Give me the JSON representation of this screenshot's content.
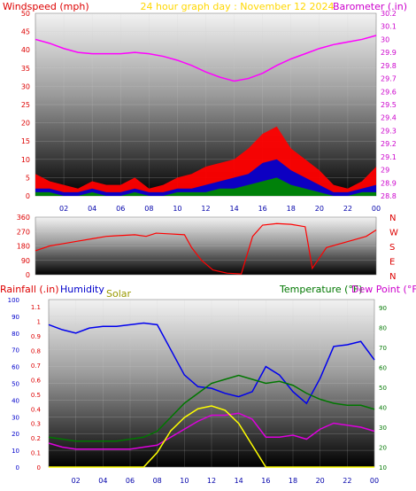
{
  "header": {
    "left_label": "Windspeed (mph)",
    "center_label": "24 hour graph day : November 12 2024",
    "right_label": "Barometer (.in)"
  },
  "colors": {
    "wind_label": "#dd0000",
    "title": "#ffd700",
    "baro_label": "#cc00cc",
    "rain_label": "#dd0000",
    "humidity_label": "#0000cc",
    "solar_label": "#999900",
    "temp_label": "#007700",
    "dew_label": "#cc00cc"
  },
  "chart_data": [
    {
      "type": "line",
      "name": "wind-barometer",
      "x": [
        0,
        1,
        2,
        3,
        4,
        5,
        6,
        7,
        8,
        9,
        10,
        11,
        12,
        13,
        14,
        15,
        16,
        17,
        18,
        19,
        20,
        21,
        22,
        23,
        24
      ],
      "x_ticks": [
        "02",
        "04",
        "06",
        "08",
        "10",
        "12",
        "14",
        "16",
        "18",
        "20",
        "22",
        "00"
      ],
      "left_axis": {
        "ticks": [
          "0",
          "5",
          "10",
          "15",
          "20",
          "25",
          "30",
          "35",
          "40",
          "45",
          "50"
        ],
        "ylim": [
          0,
          50
        ]
      },
      "right_axis": {
        "ticks": [
          "28.8",
          "28.9",
          "29",
          "29.1",
          "29.2",
          "29.3",
          "29.4",
          "29.5",
          "29.6",
          "29.7",
          "29.8",
          "29.9",
          "30",
          "30.1",
          "30.2"
        ],
        "ylim": [
          28.8,
          30.2
        ]
      },
      "series": [
        {
          "axis": "left",
          "color": "#ff0000",
          "values": [
            6,
            4,
            3,
            2,
            4,
            3,
            3,
            5,
            2,
            3,
            5,
            6,
            8,
            9,
            10,
            13,
            17,
            19,
            13,
            10,
            7,
            3,
            2,
            4,
            8
          ]
        },
        {
          "axis": "left",
          "color": "#0000cc",
          "values": [
            2,
            2,
            1,
            1,
            2,
            1,
            1,
            2,
            1,
            1,
            2,
            2,
            3,
            4,
            5,
            6,
            9,
            10,
            7,
            5,
            3,
            1,
            1,
            2,
            3
          ]
        },
        {
          "axis": "left",
          "color": "#008800",
          "values": [
            1,
            1,
            0,
            0,
            1,
            0,
            0,
            1,
            0,
            0,
            1,
            1,
            1,
            2,
            2,
            3,
            4,
            5,
            3,
            2,
            1,
            0,
            0,
            1,
            1
          ]
        },
        {
          "axis": "right",
          "color": "#ff00ff",
          "values": [
            30.0,
            29.97,
            29.93,
            29.9,
            29.89,
            29.89,
            29.89,
            29.9,
            29.89,
            29.87,
            29.84,
            29.8,
            29.75,
            29.71,
            29.68,
            29.7,
            29.74,
            29.8,
            29.85,
            29.89,
            29.93,
            29.96,
            29.98,
            30.0,
            30.03
          ]
        }
      ]
    },
    {
      "type": "line",
      "name": "wind-direction",
      "x": [
        0,
        1,
        2,
        3,
        4,
        5,
        6,
        7,
        7.8,
        8.5,
        9.5,
        10.5,
        11,
        11.7,
        12.5,
        13.5,
        14.5,
        15.3,
        16,
        17,
        18,
        19,
        19.5,
        20.5,
        21.5,
        22.5,
        23.3,
        24
      ],
      "left_axis": {
        "ticks": [
          "0",
          "90",
          "180",
          "270",
          "360"
        ],
        "ylim": [
          0,
          360
        ]
      },
      "right_labels": [
        "N",
        "W",
        "S",
        "E",
        "N"
      ],
      "series": [
        {
          "color": "#ff0000",
          "values": [
            150,
            180,
            195,
            210,
            225,
            240,
            245,
            250,
            240,
            260,
            255,
            250,
            170,
            90,
            30,
            10,
            5,
            240,
            310,
            320,
            315,
            300,
            40,
            170,
            195,
            220,
            240,
            280
          ]
        }
      ]
    },
    {
      "type": "line",
      "name": "rain-humidity-solar-temperature",
      "x": [
        0,
        1,
        2,
        3,
        4,
        5,
        6,
        7,
        8,
        9,
        10,
        11,
        12,
        13,
        14,
        15,
        16,
        17,
        18,
        19,
        20,
        21,
        22,
        23,
        24
      ],
      "left_labels": {
        "rain": "Rainfall (.in)",
        "humidity": "Humidity",
        "solar": "Solar"
      },
      "right_labels": {
        "temperature": "Temperature (°F)",
        "dew": "Dew Point (°F)"
      },
      "axes": {
        "humidity_ticks": [
          "0",
          "10",
          "20",
          "30",
          "40",
          "50",
          "60",
          "70",
          "80",
          "90",
          "100"
        ],
        "rain_ticks": [
          "0",
          "0.1",
          "0.2",
          "0.3",
          "0.4",
          "0.5",
          "0.6",
          "0.7",
          "0.8",
          "0.9",
          "1",
          "1.1"
        ],
        "temp_ticks": [
          "10",
          "20",
          "30",
          "40",
          "50",
          "60",
          "70",
          "80",
          "90"
        ],
        "rain_ylim": [
          0,
          1.15
        ],
        "temp_ylim": [
          10,
          94
        ]
      },
      "series": [
        {
          "key": "humidity",
          "color": "#0000ee",
          "unit": "percent",
          "values": [
            85,
            82,
            80,
            83,
            84,
            84,
            85,
            86,
            85,
            70,
            55,
            48,
            47,
            44,
            42,
            45,
            60,
            55,
            45,
            38,
            53,
            72,
            73,
            75,
            64
          ]
        },
        {
          "key": "temperature",
          "color": "#007700",
          "unit": "F",
          "values": [
            25,
            24,
            23,
            23,
            23,
            23,
            24,
            25,
            28,
            35,
            42,
            47,
            52,
            54,
            56,
            54,
            52,
            53,
            51,
            47,
            44,
            42,
            41,
            41,
            39
          ]
        },
        {
          "key": "dew",
          "color": "#dd00dd",
          "unit": "F",
          "values": [
            22,
            20,
            19,
            19,
            19,
            19,
            19,
            20,
            21,
            25,
            29,
            33,
            36,
            36,
            37,
            34,
            25,
            25,
            26,
            24,
            29,
            32,
            31,
            30,
            28
          ]
        },
        {
          "key": "solar",
          "color": "#ffff00",
          "unit": "rain-scale",
          "values": [
            0,
            0,
            0,
            0,
            0,
            0,
            0,
            0,
            0.1,
            0.25,
            0.34,
            0.4,
            0.42,
            0.39,
            0.3,
            0.15,
            0,
            0,
            0,
            0,
            0,
            0,
            0,
            0,
            0
          ]
        }
      ]
    }
  ]
}
